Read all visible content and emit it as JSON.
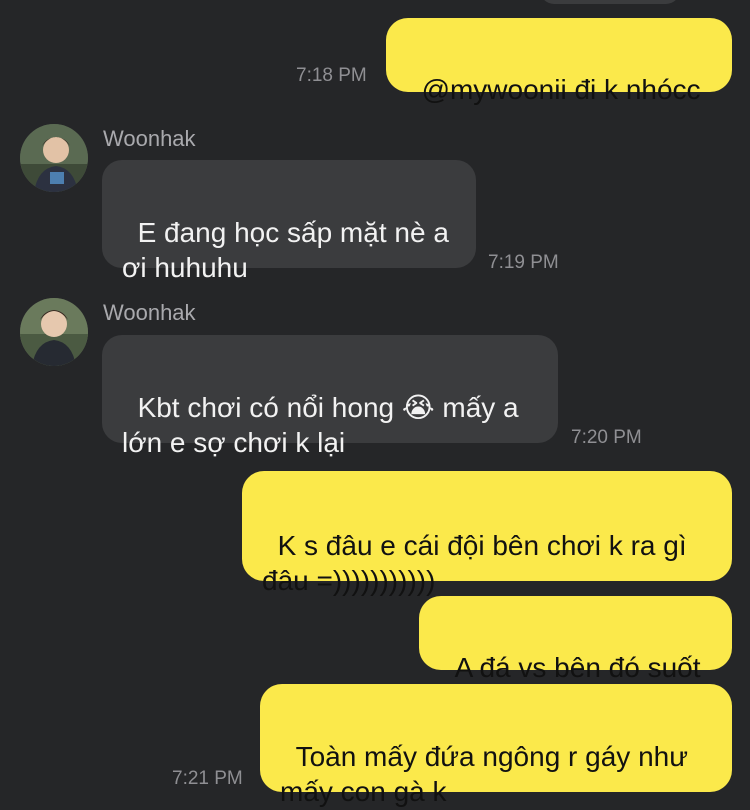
{
  "conversation": {
    "messages": [
      {
        "text": "@mywoonii đi k nhócc",
        "time": "7:18 PM"
      },
      {
        "sender": "Woonhak",
        "avatar": "profile-photo",
        "text": "E đang học sấp mặt nè a\nơi huhuhu",
        "time": "7:19 PM"
      },
      {
        "sender": "Woonhak",
        "avatar": "profile-photo",
        "text": "Kbt chơi có nổi hong 😭 mấy a\nlớn e sợ chơi k lại",
        "time": "7:20 PM"
      },
      {
        "text": "K s đâu e cái đội bên chơi k ra gì\nđâu =)))))))))))"
      },
      {
        "text": "A đá vs bên đó suốt"
      },
      {
        "text": "Toàn mấy đứa ngông r gáy như\nmấy con gà k",
        "time": "7:21 PM"
      }
    ]
  },
  "colors": {
    "background": "#252628",
    "outgoing_bubble": "#fbe94b",
    "incoming_bubble": "#3b3c3e",
    "timestamp": "#8f8f93"
  }
}
